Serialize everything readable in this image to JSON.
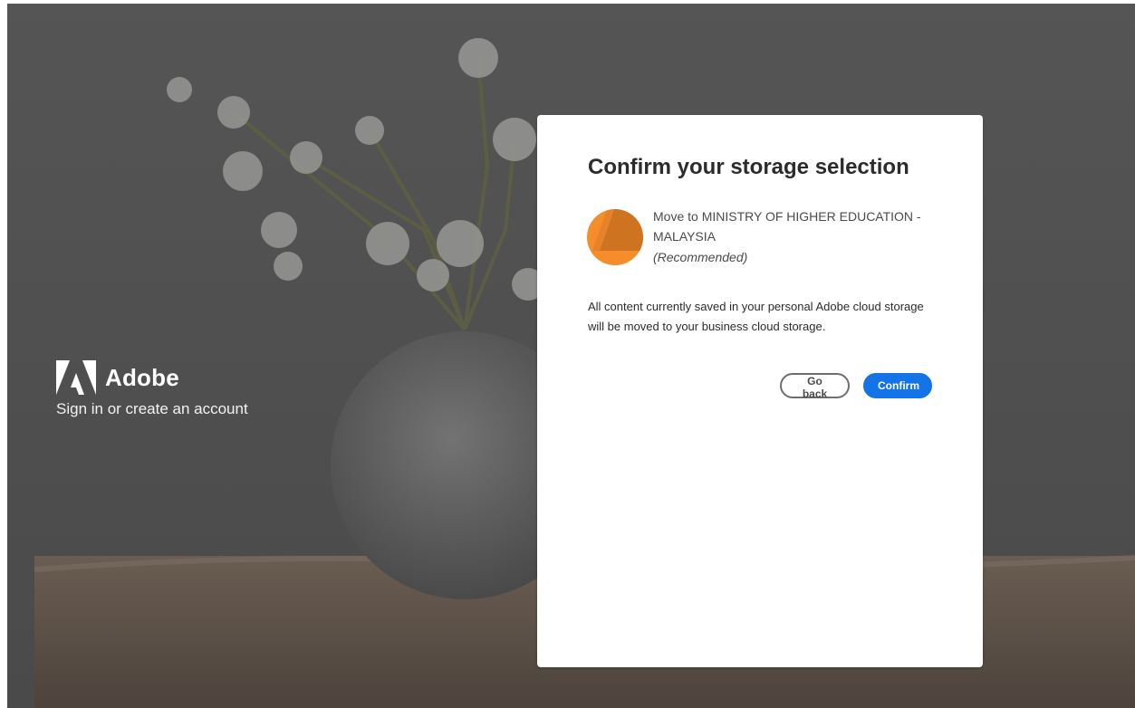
{
  "brand": {
    "name": "Adobe",
    "tagline": "Sign in or create an account"
  },
  "dialog": {
    "title": "Confirm your storage selection",
    "option": {
      "label": "Move to MINISTRY OF HIGHER EDUCATION - MALAYSIA",
      "note": "(Recommended)",
      "avatar_color": "#f58d2a"
    },
    "description": "All content currently saved in your personal Adobe cloud storage will be moved to your business cloud storage.",
    "buttons": {
      "back_label": "Go back",
      "confirm_label": "Confirm"
    }
  },
  "colors": {
    "accent": "#1473e6",
    "background_overlay": "#4e4e4e",
    "card": "#ffffff",
    "avatar_orange": "#f58d2a"
  },
  "icons": {
    "brand_logo": "adobe-logo-icon",
    "org_avatar": "organization-avatar-icon"
  }
}
